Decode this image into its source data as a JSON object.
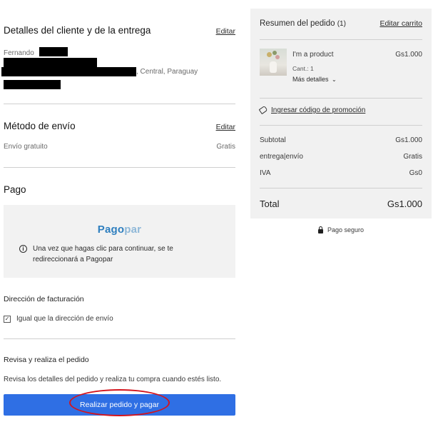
{
  "customer": {
    "title": "Detalles del cliente y de la entrega",
    "edit_label": "Editar",
    "first_name": "Fernando",
    "address_suffix": ", Central, Paraguay"
  },
  "shipping": {
    "title": "Método de envío",
    "edit_label": "Editar",
    "method": "Envío gratuito",
    "price": "Gratis"
  },
  "payment": {
    "title": "Pago",
    "provider_logo": {
      "part1": "Pago",
      "part2": "par"
    },
    "info_line1": "Una vez que hagas clic para continuar, se te",
    "info_line2": "redireccionará a Pagopar"
  },
  "billing": {
    "title": "Dirección de facturación",
    "same_as_shipping_label": "Igual que la dirección de envío",
    "same_as_shipping_checked": true
  },
  "review": {
    "title": "Revisa y realiza el pedido",
    "text": "Revisa los detalles del pedido y realiza tu compra cuando estés listo.",
    "place_order_label": "Realizar pedido y pagar"
  },
  "summary": {
    "title": "Resumen del pedido",
    "count": "(1)",
    "edit_cart_label": "Editar carrito",
    "item": {
      "name": "I'm a product",
      "price": "Gs1.000",
      "qty": "Cant.: 1",
      "more_details": "Más detalles",
      "more_details_icon": "chevron-down-icon"
    },
    "promo_label": "Ingresar código de promoción",
    "promo_icon": "tag-icon",
    "rows": [
      {
        "label": "Subtotal",
        "value": "Gs1.000"
      },
      {
        "label": "entrega|envío",
        "value": "Gratis"
      },
      {
        "label": "IVA",
        "value": "Gs0"
      }
    ],
    "total_label": "Total",
    "total_value": "Gs1.000"
  },
  "secure": {
    "label": "Pago seguro",
    "icon": "lock-icon"
  },
  "colors": {
    "primary_button": "#2f6fe4",
    "annotation_circle": "#d4141c",
    "panel_bg": "#f1f1f1",
    "pagopar_blue": "#2e7fbf"
  }
}
